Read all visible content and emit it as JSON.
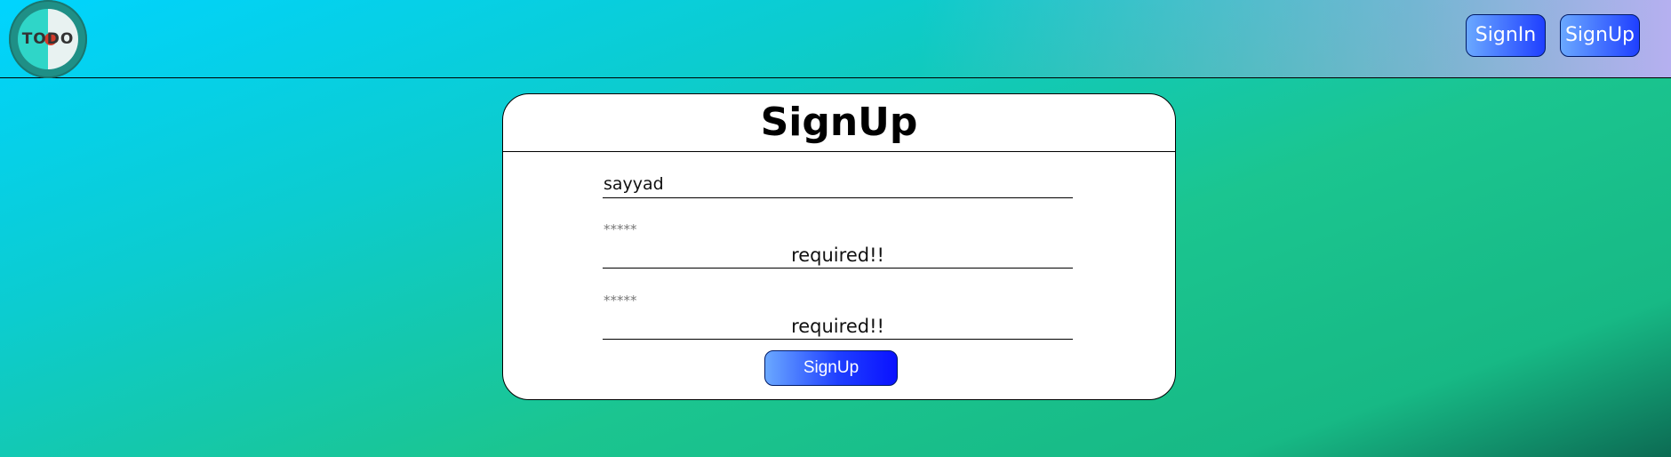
{
  "header": {
    "logo_text": "TODO",
    "nav": {
      "signin_label": "SignIn",
      "signup_label": "SignUp"
    }
  },
  "form": {
    "title": "SignUp",
    "username": {
      "value": "sayyad"
    },
    "password": {
      "placeholder": "*****",
      "validation": "required!!"
    },
    "confirm_password": {
      "placeholder": "*****",
      "validation": "required!!"
    },
    "submit_label": "SignUp"
  },
  "colors": {
    "button_gradient_start": "#6aa8ff",
    "button_gradient_end": "#1f3fff",
    "background_start": "#00d4ff",
    "background_mid": "#1bc590",
    "background_end": "#0c6b53"
  }
}
